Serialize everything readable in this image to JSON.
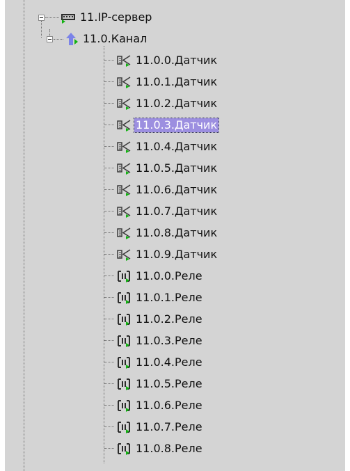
{
  "tree": {
    "server": {
      "label": "11.IP-сервер",
      "icon": "ip-server-icon"
    },
    "channel": {
      "label": "11.0.Канал",
      "icon": "channel-icon"
    },
    "sensors": [
      {
        "label": "11.0.0.Датчик",
        "selected": false
      },
      {
        "label": "11.0.1.Датчик",
        "selected": false
      },
      {
        "label": "11.0.2.Датчик",
        "selected": false
      },
      {
        "label": "11.0.3.Датчик",
        "selected": true
      },
      {
        "label": "11.0.4.Датчик",
        "selected": false
      },
      {
        "label": "11.0.5.Датчик",
        "selected": false
      },
      {
        "label": "11.0.6.Датчик",
        "selected": false
      },
      {
        "label": "11.0.7.Датчик",
        "selected": false
      },
      {
        "label": "11.0.8.Датчик",
        "selected": false
      },
      {
        "label": "11.0.9.Датчик",
        "selected": false
      }
    ],
    "relays": [
      {
        "label": "11.0.0.Реле"
      },
      {
        "label": "11.0.1.Реле"
      },
      {
        "label": "11.0.2.Реле"
      },
      {
        "label": "11.0.3.Реле"
      },
      {
        "label": "11.0.4.Реле"
      },
      {
        "label": "11.0.5.Реле"
      },
      {
        "label": "11.0.6.Реле"
      },
      {
        "label": "11.0.7.Реле"
      },
      {
        "label": "11.0.8.Реле"
      }
    ],
    "colors": {
      "background": "#d4d4d4",
      "selection": "#9c8fe0",
      "active_marker": "#11b211",
      "channel_arrow": "#7b83e8"
    }
  }
}
